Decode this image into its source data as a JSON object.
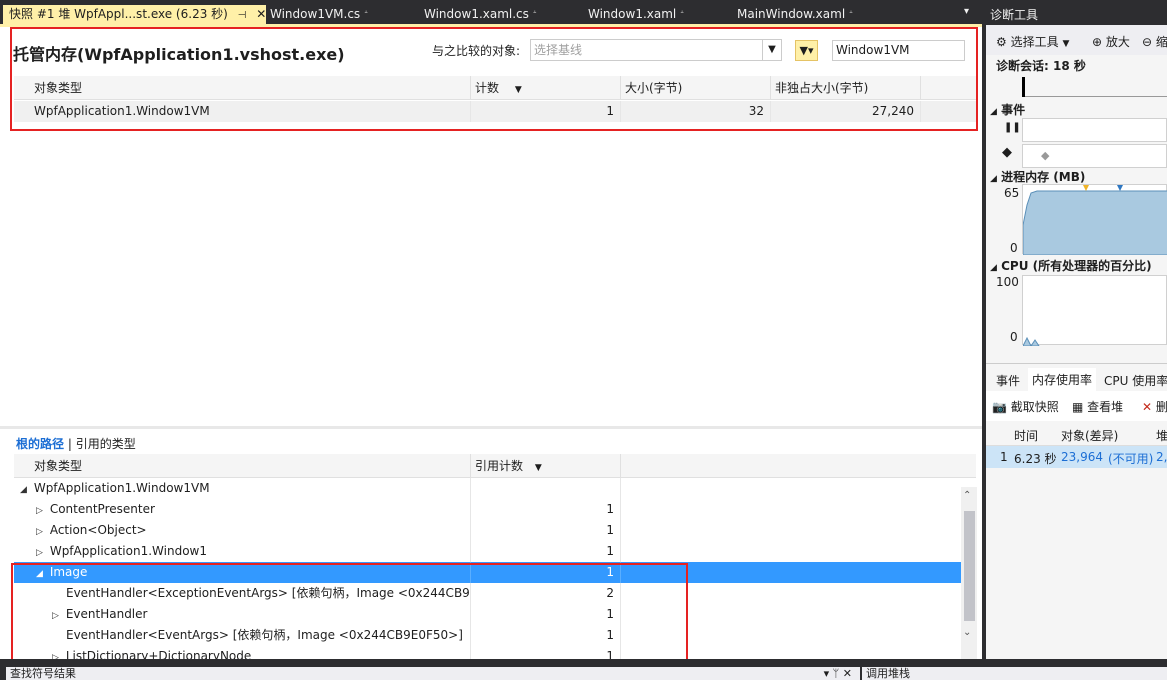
{
  "tabs": [
    {
      "label": "快照 #1 堆 WpfAppl...st.exe (6.23 秒)",
      "pin": "⊣",
      "close": "✕",
      "active": true
    },
    {
      "label": "Window1VM.cs",
      "lock": "🔒"
    },
    {
      "label": "Window1.xaml.cs",
      "lock": "🔒"
    },
    {
      "label": "Window1.xaml",
      "lock": "🔒"
    },
    {
      "label": "MainWindow.xaml",
      "lock": "🔒"
    }
  ],
  "heap": {
    "title": "托管内存(WpfApplication1.vshost.exe)",
    "compare_label": "与之比较的对象:",
    "baseline_placeholder": "选择基线",
    "filter_value": "Window1VM",
    "columns": [
      "对象类型",
      "计数",
      "大小(字节)",
      "非独占大小(字节)"
    ],
    "rows": [
      {
        "type": "WpfApplication1.Window1VM",
        "count": "1",
        "size": "32",
        "inclusive": "27,240"
      }
    ]
  },
  "lower": {
    "tab_active": "根的路径",
    "tab_sep": "|",
    "tab_other": "引用的类型",
    "columns": [
      "对象类型",
      "引用计数"
    ],
    "rows": [
      {
        "indent": 0,
        "tri": "◢",
        "label": "WpfApplication1.Window1VM",
        "count": ""
      },
      {
        "indent": 1,
        "tri": "▷",
        "label": "ContentPresenter",
        "count": "1"
      },
      {
        "indent": 1,
        "tri": "▷",
        "label": "Action<Object>",
        "count": "1"
      },
      {
        "indent": 1,
        "tri": "▷",
        "label": "WpfApplication1.Window1",
        "count": "1"
      },
      {
        "indent": 1,
        "tri": "◢",
        "label": "Image",
        "count": "1",
        "selected": true
      },
      {
        "indent": 2,
        "tri": "",
        "label": "EventHandler<ExceptionEventArgs> [依赖句柄，Image <0x244CB9E...",
        "count": "2"
      },
      {
        "indent": 2,
        "tri": "▷",
        "label": "EventHandler",
        "count": "1"
      },
      {
        "indent": 2,
        "tri": "",
        "label": "EventHandler<EventArgs> [依赖句柄，Image <0x244CB9E0F50>]",
        "count": "1"
      },
      {
        "indent": 2,
        "tri": "▷",
        "label": "ListDictionary+DictionaryNode",
        "count": "1"
      }
    ]
  },
  "diag": {
    "title": "诊断工具",
    "select_tool": "选择工具",
    "zoom_in": "放大",
    "zoom_other": "缩",
    "session": "诊断会话: 18 秒",
    "events_label": "事件",
    "pause_icon": "❚❚",
    "memory_label": "进程内存 (MB)",
    "memory_max": "65",
    "memory_min": "0",
    "cpu_label": "CPU (所有处理器的百分比)",
    "cpu_max": "100",
    "cpu_min": "0",
    "bottom_tabs": [
      "事件",
      "内存使用率",
      "CPU 使用率"
    ],
    "snapshot_btn": "截取快照",
    "view_heap_btn": "查看堆",
    "delete_btn": "删",
    "table_cols": [
      "时间",
      "对象(差异)",
      "堆"
    ],
    "table_row": {
      "index": "1",
      "time": "6.23 秒",
      "objects": "23,964",
      "diff": "(不可用)",
      "heap": "2,"
    }
  },
  "bottom": {
    "left_title": "查找符号结果",
    "left_controls": "▾ ᛘ ✕",
    "right_title": "调用堆栈"
  },
  "colors": {
    "accent_tab": "#fff0a8",
    "selection": "#3399ff",
    "highlight_box": "#e52222",
    "memory_fill": "#a9c9e0"
  }
}
